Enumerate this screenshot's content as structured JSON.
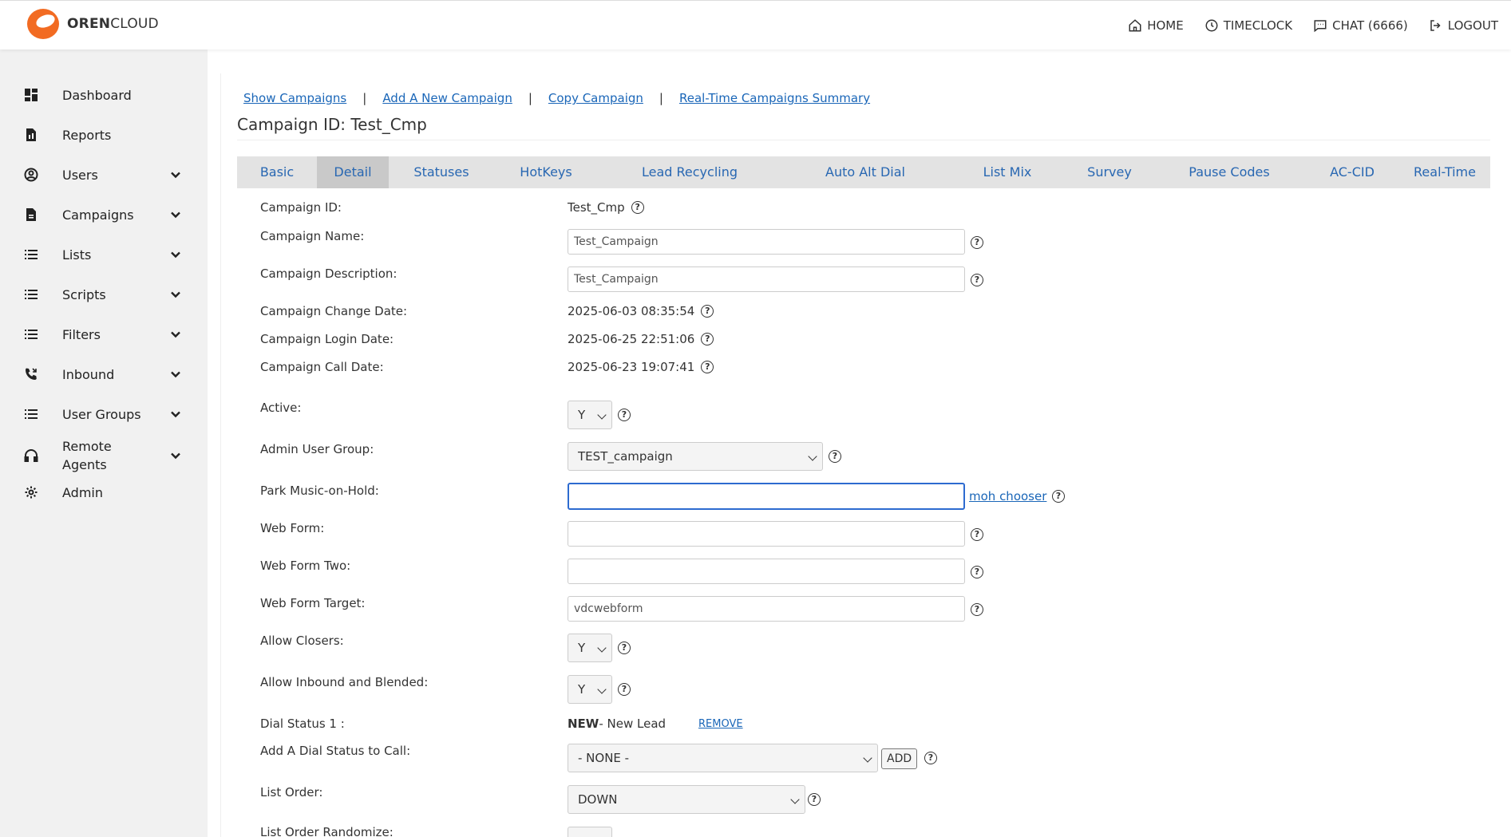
{
  "brand": {
    "name_bold": "OREN",
    "name_rest": "CLOUD"
  },
  "topnav": [
    {
      "label": "HOME",
      "icon": "home-icon"
    },
    {
      "label": "TIMECLOCK",
      "icon": "clock-icon"
    },
    {
      "label": "CHAT (6666)",
      "icon": "chat-icon"
    },
    {
      "label": "LOGOUT",
      "icon": "logout-icon"
    }
  ],
  "sidebar": {
    "items": [
      {
        "label": "Dashboard",
        "icon": "dashboard-icon",
        "expandable": false
      },
      {
        "label": "Reports",
        "icon": "report-icon",
        "expandable": false
      },
      {
        "label": "Users",
        "icon": "user-circle-icon",
        "expandable": true
      },
      {
        "label": "Campaigns",
        "icon": "document-icon",
        "expandable": true
      },
      {
        "label": "Lists",
        "icon": "list-icon",
        "expandable": true
      },
      {
        "label": "Scripts",
        "icon": "list-icon",
        "expandable": true
      },
      {
        "label": "Filters",
        "icon": "list-icon",
        "expandable": true
      },
      {
        "label": "Inbound",
        "icon": "phone-icon",
        "expandable": true
      },
      {
        "label": "User Groups",
        "icon": "list-icon",
        "expandable": true
      },
      {
        "label": "Remote Agents",
        "icon": "headset-icon",
        "expandable": true
      },
      {
        "label": "Admin",
        "icon": "gear-icon",
        "expandable": false
      }
    ]
  },
  "links": {
    "show_campaigns": "Show Campaigns",
    "add_campaign": "Add A New Campaign",
    "copy_campaign": "Copy Campaign",
    "realtime_summary": "Real-Time Campaigns Summary",
    "separator": "|"
  },
  "page_title": "Campaign ID: Test_Cmp",
  "tabs": [
    "Basic",
    "Detail",
    "Statuses",
    "HotKeys",
    "Lead Recycling",
    "Auto Alt Dial",
    "List Mix",
    "Survey",
    "Pause Codes",
    "AC-CID",
    "Real-Time"
  ],
  "active_tab": "Detail",
  "form": {
    "help_glyph": "?",
    "campaign_id": {
      "label": "Campaign ID:",
      "value": "Test_Cmp"
    },
    "campaign_name": {
      "label": "Campaign Name:",
      "value": "Test_Campaign"
    },
    "campaign_description": {
      "label": "Campaign Description:",
      "value": "Test_Campaign"
    },
    "change_date": {
      "label": "Campaign Change Date:",
      "value": "2025-06-03 08:35:54"
    },
    "login_date": {
      "label": "Campaign Login Date:",
      "value": "2025-06-25 22:51:06"
    },
    "call_date": {
      "label": "Campaign Call Date:",
      "value": "2025-06-23 19:07:41"
    },
    "active": {
      "label": "Active:",
      "value": "Y"
    },
    "admin_user_group": {
      "label": "Admin User Group:",
      "value": "TEST_campaign"
    },
    "park_moh": {
      "label": "Park Music-on-Hold:",
      "value": "",
      "chooser": "moh chooser"
    },
    "web_form": {
      "label": "Web Form:",
      "value": ""
    },
    "web_form_two": {
      "label": "Web Form Two:",
      "value": ""
    },
    "web_form_target": {
      "label": "Web Form Target:",
      "value": "vdcwebform"
    },
    "allow_closers": {
      "label": "Allow Closers:",
      "value": "Y"
    },
    "allow_inbound_blended": {
      "label": "Allow Inbound and Blended:",
      "value": "Y"
    },
    "dial_status_1": {
      "label": "Dial Status 1 :",
      "code": "NEW",
      "desc": " - New Lead",
      "remove": "REMOVE"
    },
    "add_dial_status": {
      "label": "Add A Dial Status to Call:",
      "value": "- NONE -",
      "button": "ADD"
    },
    "list_order": {
      "label": "List Order:",
      "value": "DOWN"
    },
    "list_order_randomize": {
      "label": "List Order Randomize:"
    }
  }
}
